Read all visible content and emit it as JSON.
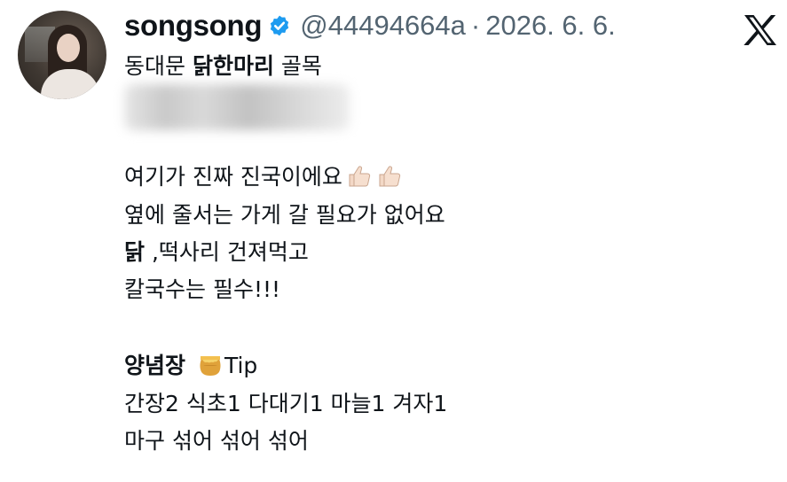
{
  "tweet": {
    "display_name": "songsong",
    "handle": "@44494664a",
    "separator": "·",
    "date": "2026. 6. 6.",
    "colors": {
      "verified": "#1d9bf0",
      "text": "#0f1419",
      "meta": "#536471"
    },
    "icons": [
      "verified-badge-icon",
      "x-logo-icon",
      "thumbs-up-icon",
      "honey-pot-icon"
    ],
    "lines": {
      "l1_a": "동대문 ",
      "l1_b": "닭한마리",
      "l1_c": " 골목",
      "l2": "여기가 진짜 진국이에요",
      "l3": "옆에 줄서는 가게 갈 필요가 없어요",
      "l4_a": "닭",
      "l4_b": " ,떡사리 건져먹고",
      "l5": "칼국수는 필수!!!",
      "l6_a": "양념장",
      "l6_b": "Tip",
      "l7": "간장2 식초1 다대기1 마늘1 겨자1",
      "l8": "마구 섞어 섞어 섞어"
    }
  }
}
